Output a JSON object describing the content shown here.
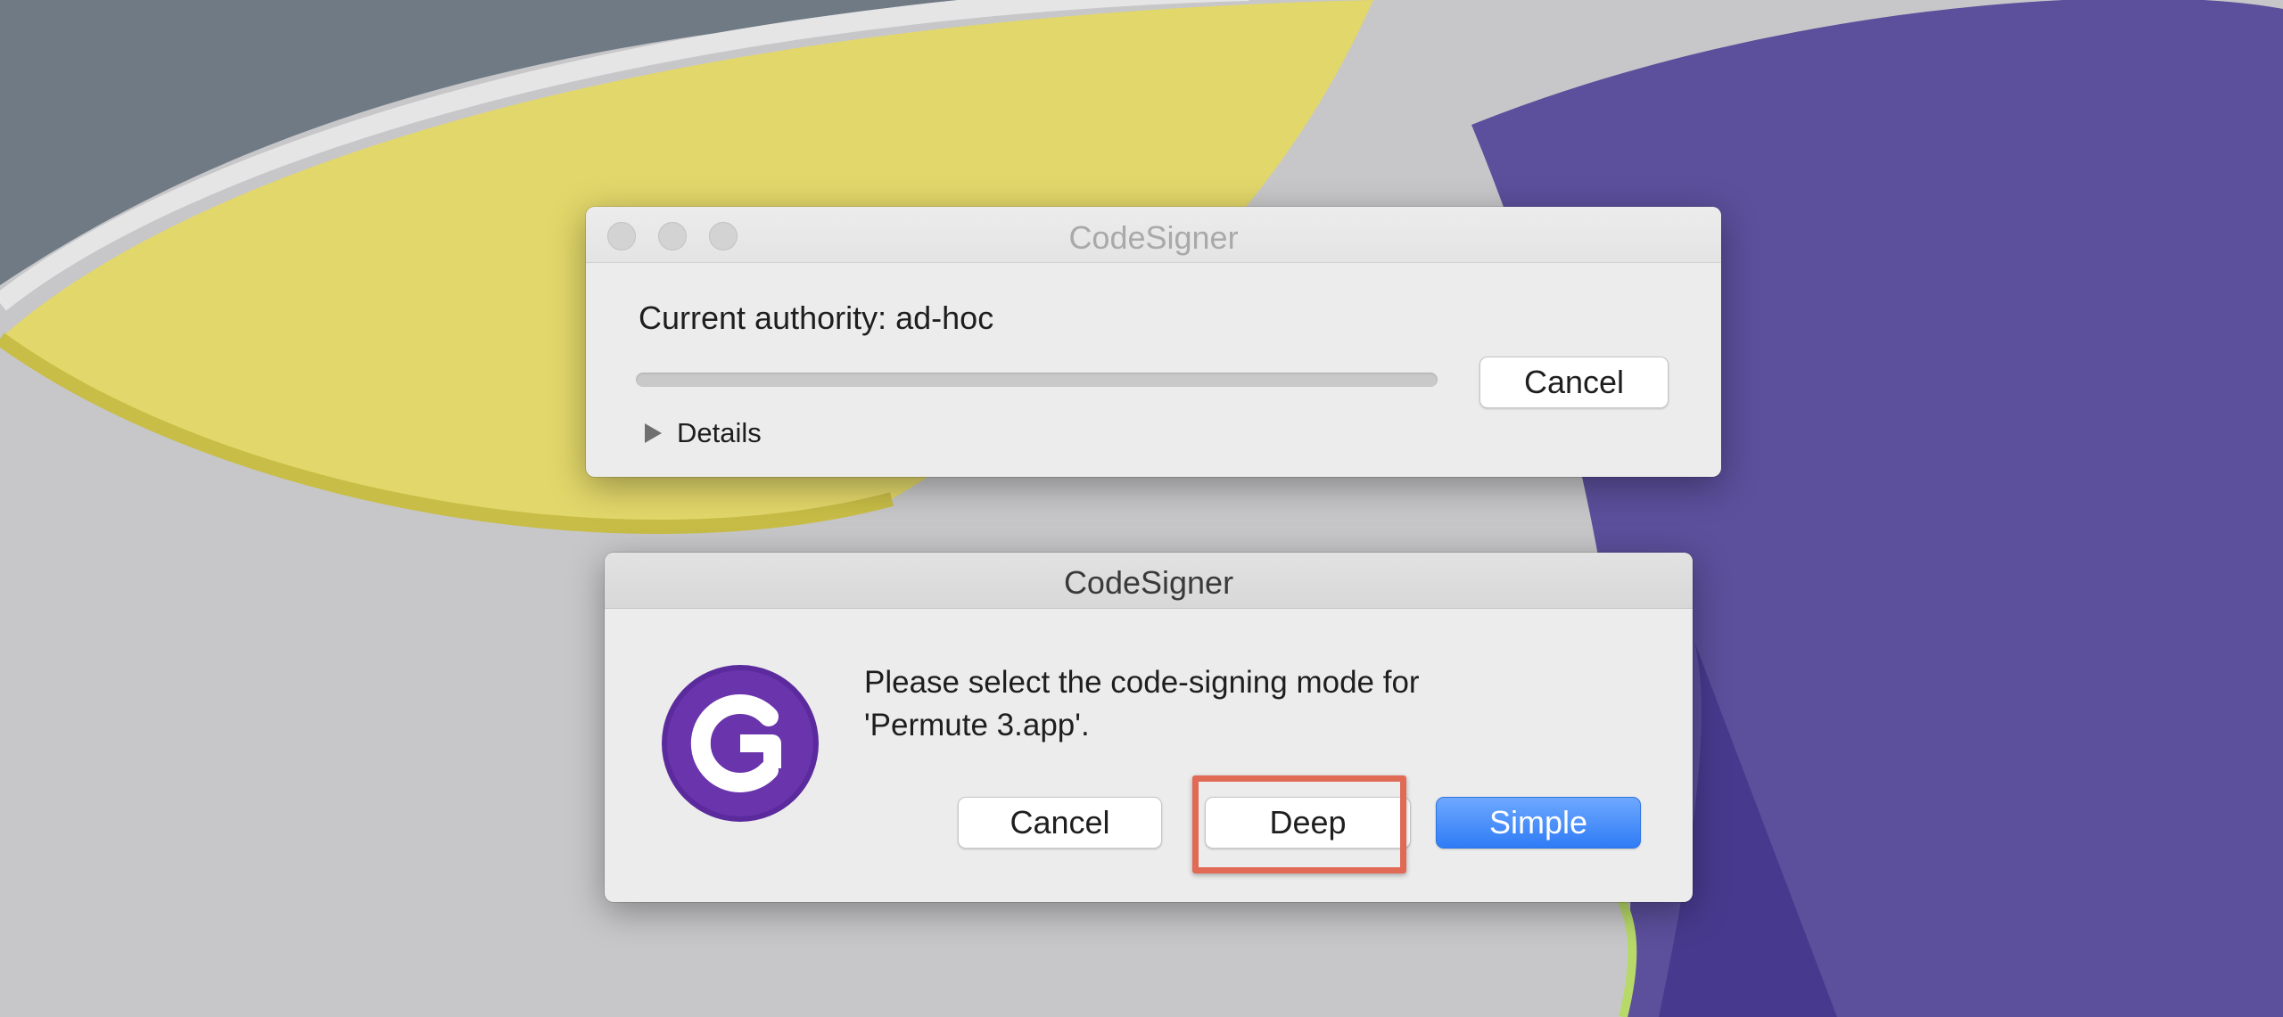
{
  "progress_window": {
    "title": "CodeSigner",
    "authority_label": "Current authority: ad-hoc",
    "cancel_label": "Cancel",
    "details_label": "Details",
    "progress_fraction": 0.0
  },
  "alert_window": {
    "title": "CodeSigner",
    "message": "Please select the code-signing mode for 'Permute 3.app'.",
    "buttons": {
      "cancel": "Cancel",
      "deep": "Deep",
      "simple": "Simple"
    }
  },
  "icons": {
    "app_icon": "codesigner-app-icon",
    "details": "disclosure-triangle-icon"
  },
  "colors": {
    "primary_button": "#2f7cf6",
    "highlight": "#e06a55",
    "app_icon": "#5b2a9c"
  }
}
